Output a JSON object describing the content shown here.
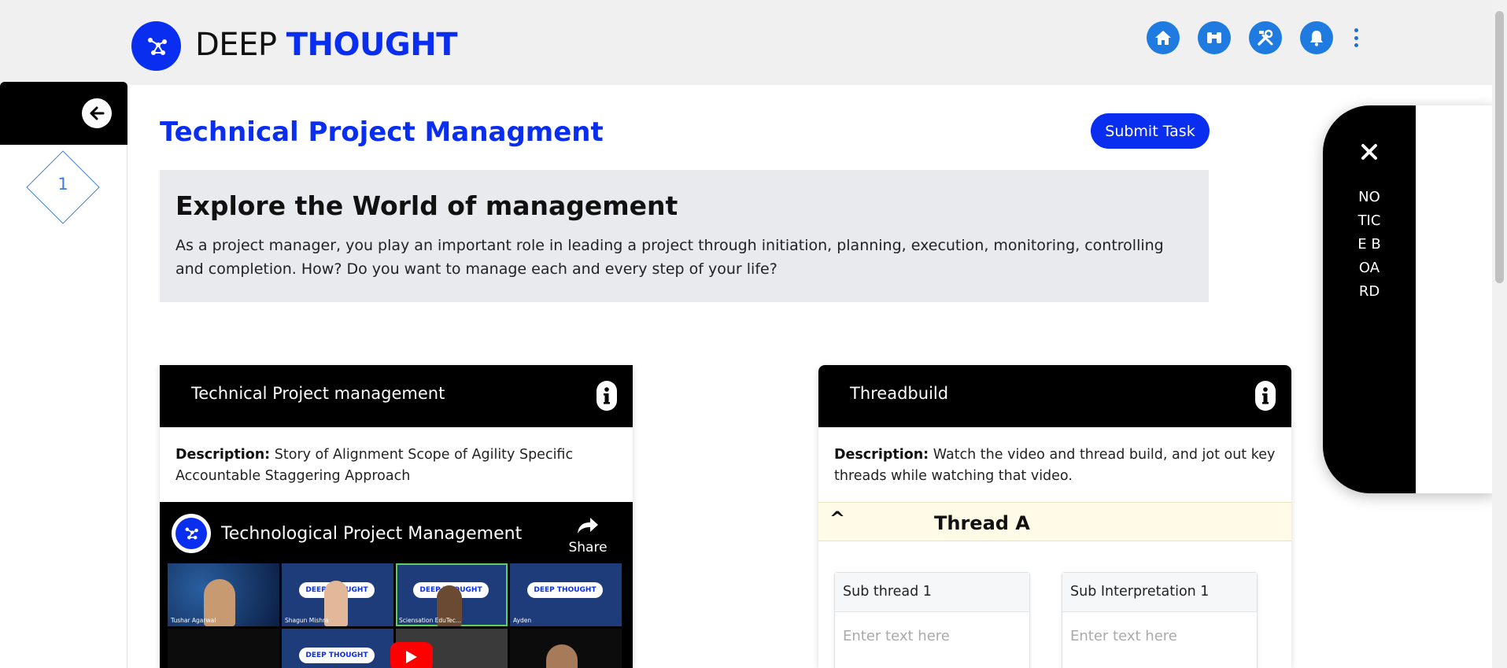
{
  "header": {
    "brand_part1": "DEEP",
    "brand_part2": "THOUGHT",
    "nav_icons": [
      "home-icon",
      "binoculars-icon",
      "tools-icon",
      "bell-icon"
    ],
    "more_icon": "kebab-menu-icon",
    "brand_color": "#0a2ef0",
    "nav_icon_color": "#1f7be0"
  },
  "sidebar": {
    "back_icon": "arrow-left-icon",
    "steps": [
      {
        "label": "1"
      }
    ]
  },
  "main": {
    "title": "Technical Project Managment",
    "submit_label": "Submit Task",
    "intro": {
      "heading": "Explore the World of management",
      "body": "As a project manager, you play an important role in leading a project through initiation, planning, execution, monitoring, controlling and completion. How? Do you want to manage each and every step of your life?"
    }
  },
  "cards": {
    "video_card": {
      "title": "Technical Project management",
      "desc_label": "Description:",
      "desc_text": "Story of Alignment Scope of Agility Specific Accountable Staggering Approach",
      "video": {
        "title": "Technological Project Management",
        "share_label": "Share",
        "tile_logo": "DEEP THOUGHT",
        "participants": [
          "Tushar Agarwal",
          "Shagun Mishra",
          "Sciensation EduTec...",
          "Ayden"
        ]
      }
    },
    "thread_card": {
      "title": "Threadbuild",
      "desc_label": "Description:",
      "desc_text": "Watch the video and thread build, and jot out key threads while watching that video.",
      "thread": {
        "caret": "^",
        "title": "Thread A",
        "sub_thread_label": "Sub thread 1",
        "sub_interp_label": "Sub Interpretation 1",
        "placeholder": "Enter text here"
      }
    }
  },
  "notice_board": {
    "close_icon": "close-icon",
    "label": "NOTICE BOARD"
  }
}
